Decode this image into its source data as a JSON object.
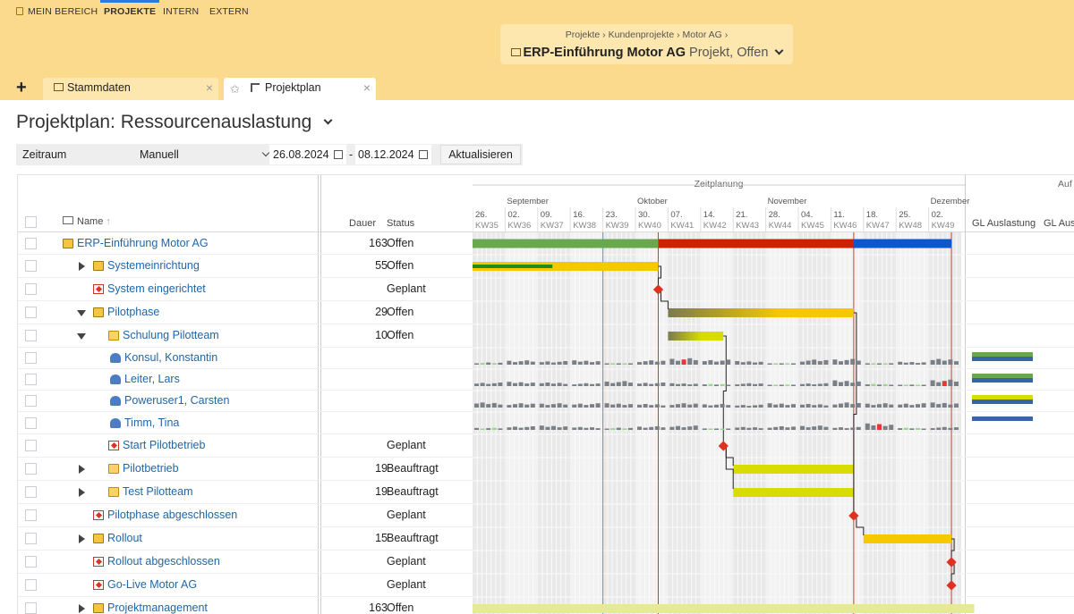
{
  "topnav": {
    "items": [
      {
        "label": "MEIN BEREICH",
        "active": false
      },
      {
        "label": "PROJEKTE",
        "active": true
      },
      {
        "label": "INTERN",
        "active": false
      },
      {
        "label": "EXTERN",
        "active": false
      }
    ]
  },
  "breadcrumb": {
    "path": "Projekte  ›  Kundenprojekte  ›  Motor AG  ›",
    "title": "ERP-Einführung Motor AG",
    "subtitle": "Projekt, Offen"
  },
  "tabs": [
    {
      "label": "Stammdaten",
      "active": false
    },
    {
      "label": "Projektplan",
      "active": true
    }
  ],
  "page": {
    "title": "Projektplan: Ressourcenauslastung"
  },
  "filter": {
    "label": "Zeitraum",
    "mode": "Manuell",
    "date_from": "26.08.2024",
    "date_sep": "-",
    "date_to": "08.12.2024",
    "refresh": "Aktualisieren"
  },
  "grid": {
    "columns": {
      "name": "Name",
      "duration": "Dauer",
      "status": "Status"
    },
    "section_label": "Zeitplanung",
    "section2_label": "Auf",
    "load_cols": [
      "GL Auslastung",
      "GL Ausl"
    ],
    "months": [
      {
        "label": "September",
        "kw": 36
      },
      {
        "label": "Oktober",
        "kw": 40
      },
      {
        "label": "November",
        "kw": 44
      },
      {
        "label": "Dezember",
        "kw": 49
      }
    ],
    "weeks": [
      {
        "day": "26.",
        "kw": "KW35"
      },
      {
        "day": "02.",
        "kw": "KW36"
      },
      {
        "day": "09.",
        "kw": "KW37"
      },
      {
        "day": "16.",
        "kw": "KW38"
      },
      {
        "day": "23.",
        "kw": "KW39"
      },
      {
        "day": "30.",
        "kw": "KW40"
      },
      {
        "day": "07.",
        "kw": "KW41"
      },
      {
        "day": "14.",
        "kw": "KW42"
      },
      {
        "day": "21.",
        "kw": "KW43"
      },
      {
        "day": "28.",
        "kw": "KW44"
      },
      {
        "day": "04.",
        "kw": "KW45"
      },
      {
        "day": "11.",
        "kw": "KW46"
      },
      {
        "day": "18.",
        "kw": "KW47"
      },
      {
        "day": "25.",
        "kw": "KW48"
      },
      {
        "day": "02.",
        "kw": "KW49"
      }
    ],
    "rows": [
      {
        "type": "project",
        "name": "ERP-Einführung Motor AG",
        "level": 0,
        "expander": "none",
        "duration": "163",
        "status": "Offen"
      },
      {
        "type": "folder",
        "name": "Systemeinrichtung",
        "level": 1,
        "expander": "collapsed",
        "duration": "55",
        "status": "Offen"
      },
      {
        "type": "milestone",
        "name": "System eingerichtet",
        "level": 1,
        "expander": "none",
        "duration": "",
        "status": "Geplant"
      },
      {
        "type": "folder",
        "name": "Pilotphase",
        "level": 1,
        "expander": "expanded",
        "duration": "29",
        "status": "Offen"
      },
      {
        "type": "task",
        "name": "Schulung Pilotteam",
        "level": 2,
        "expander": "expanded",
        "duration": "10",
        "status": "Offen"
      },
      {
        "type": "resource",
        "name": "Konsul, Konstantin",
        "level": 3,
        "expander": "none",
        "duration": "",
        "status": ""
      },
      {
        "type": "resource",
        "name": "Leiter, Lars",
        "level": 3,
        "expander": "none",
        "duration": "",
        "status": ""
      },
      {
        "type": "resource",
        "name": "Poweruser1, Carsten",
        "level": 3,
        "expander": "none",
        "duration": "",
        "status": ""
      },
      {
        "type": "resource",
        "name": "Timm, Tina",
        "level": 3,
        "expander": "none",
        "duration": "",
        "status": ""
      },
      {
        "type": "milestone",
        "name": "Start Pilotbetrieb",
        "level": 2,
        "expander": "none",
        "duration": "",
        "status": "Geplant"
      },
      {
        "type": "task",
        "name": "Pilotbetrieb",
        "level": 2,
        "expander": "collapsed",
        "duration": "19",
        "status": "Beauftragt"
      },
      {
        "type": "task",
        "name": "Test Pilotteam",
        "level": 2,
        "expander": "collapsed",
        "duration": "19",
        "status": "Beauftragt"
      },
      {
        "type": "milestone",
        "name": "Pilotphase abgeschlossen",
        "level": 1,
        "expander": "none",
        "duration": "",
        "status": "Geplant"
      },
      {
        "type": "folder",
        "name": "Rollout",
        "level": 1,
        "expander": "collapsed",
        "duration": "15",
        "status": "Beauftragt"
      },
      {
        "type": "milestone",
        "name": "Rollout abgeschlossen",
        "level": 1,
        "expander": "none",
        "duration": "",
        "status": "Geplant"
      },
      {
        "type": "milestone",
        "name": "Go-Live Motor AG",
        "level": 1,
        "expander": "none",
        "duration": "",
        "status": "Geplant"
      },
      {
        "type": "folder",
        "name": "Projektmanagement",
        "level": 1,
        "expander": "collapsed",
        "duration": "163",
        "status": "Offen"
      }
    ]
  },
  "colors": {
    "accent": "#2a7be0",
    "nav_bg": "#fbd98d",
    "link": "#2166a8",
    "bar_green": "#6aa84f",
    "bar_red": "#cc2200",
    "bar_blue": "#0b57d0",
    "bar_yellow": "#f5c800",
    "bar_lime": "#d8dc00",
    "milestone": "#e03020"
  },
  "gantt": {
    "bars": [
      {
        "row": 0,
        "start": 35,
        "end": 40.7,
        "color": "#6aa84f"
      },
      {
        "row": 0,
        "start": 40.7,
        "end": 46.7,
        "color": "#cc2200"
      },
      {
        "row": 0,
        "start": 46.7,
        "end": 49.7,
        "color": "#0b57d0"
      },
      {
        "row": 1,
        "start": 35,
        "end": 40.7,
        "color": "#f5c800",
        "progress": 0.43
      },
      {
        "row": 3,
        "start": 41,
        "end": 46.7,
        "color": "#f5c800",
        "fade": true
      },
      {
        "row": 4,
        "start": 41,
        "end": 42.7,
        "color": "#d8dc00",
        "fade": true
      },
      {
        "row": 10,
        "start": 43,
        "end": 46.7,
        "color": "#d8dc00"
      },
      {
        "row": 11,
        "start": 43,
        "end": 46.7,
        "color": "#d8dc00"
      },
      {
        "row": 13,
        "start": 47,
        "end": 49.7,
        "color": "#f5c800"
      },
      {
        "row": 16,
        "start": 35,
        "end": 50.4,
        "color": "#e6e89a"
      }
    ],
    "milestones": [
      {
        "row": 2,
        "at": 40.7
      },
      {
        "row": 9,
        "at": 42.7
      },
      {
        "row": 12,
        "at": 46.7
      },
      {
        "row": 14,
        "at": 49.7
      },
      {
        "row": 15,
        "at": 49.7
      }
    ],
    "today_kw": 39.0,
    "marker_kws": [
      40.7,
      46.7,
      49.7
    ],
    "resource_load": [
      [
        0.3,
        0.6,
        0.5,
        0.6,
        0.2,
        0.6,
        0.9,
        0.7,
        0.5,
        0.0,
        0.7,
        0.8,
        0.2,
        0.4,
        0.8
      ],
      [
        0.5,
        0.6,
        0.5,
        0.4,
        0.7,
        0.5,
        0.4,
        0.3,
        0.4,
        0.2,
        0.4,
        0.8,
        0.3,
        0.2,
        0.9
      ],
      [
        0.7,
        0.6,
        0.6,
        0.6,
        0.6,
        0.5,
        0.6,
        0.5,
        0.4,
        0.6,
        0.5,
        0.7,
        0.6,
        0.6,
        0.7
      ],
      [
        0.3,
        0.5,
        0.6,
        0.4,
        0.3,
        0.5,
        0.6,
        0.2,
        0.4,
        0.5,
        0.6,
        0.4,
        0.9,
        0.3,
        0.4
      ]
    ],
    "load_summary": [
      [
        "#6aa84f",
        "#3a64a8"
      ],
      [
        "#6aa84f",
        "#3a64a8"
      ],
      [
        "#d8dc00",
        "#3a64a8"
      ],
      [
        "#3a64a8"
      ]
    ]
  }
}
